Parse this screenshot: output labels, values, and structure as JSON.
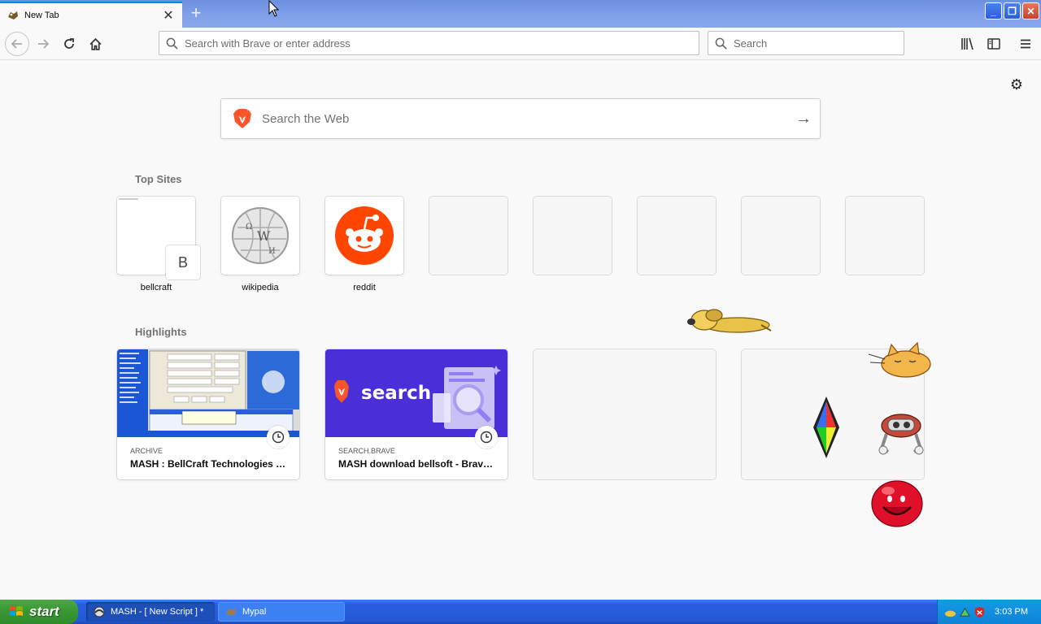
{
  "browser": {
    "tab_title": "New Tab",
    "new_tab_symbol": "+",
    "url_placeholder": "Search with Brave or enter address",
    "search_placeholder": "Search"
  },
  "newtab": {
    "web_search_placeholder": "Search the Web",
    "top_sites_title": "Top Sites",
    "top_sites": [
      {
        "label": "bellcraft",
        "letter": "B"
      },
      {
        "label": "wikipedia"
      },
      {
        "label": "reddit"
      }
    ],
    "highlights_title": "Highlights",
    "highlights": [
      {
        "source": "ARCHIVE",
        "title": "MASH : BellCraft Technologies : ..."
      },
      {
        "source": "SEARCH.BRAVE",
        "title": "MASH download bellsoft - Brave...",
        "thumb_text": "search"
      }
    ]
  },
  "taskbar": {
    "start_label": "start",
    "tasks": [
      {
        "label": "MASH - [ New Script ] *"
      },
      {
        "label": "Mypal"
      }
    ],
    "clock": "3:03 PM"
  },
  "colors": {
    "accent": "#0a84ff",
    "reddit": "#ff4500",
    "brave_search_bg": "#4a2fd8",
    "xp_taskbar": "#245edc",
    "xp_start": "#3a9a35"
  }
}
